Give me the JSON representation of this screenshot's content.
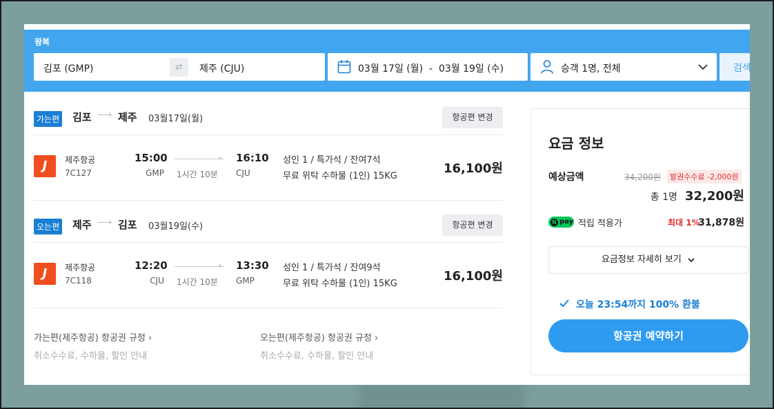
{
  "search": {
    "trip_type": "왕복",
    "from": "김포 (GMP)",
    "swap_glyph": "⇄",
    "to": "제주 (CJU)",
    "dates": "03월 17일 (월)  -  03월 19일 (수)",
    "passengers": "승객 1명, 전체",
    "search_label": "검색",
    "colors": {
      "bar": "#42a5f0",
      "accent": "#1a7fd4"
    }
  },
  "segments": [
    {
      "badge": "가는편",
      "from": "김포",
      "to": "제주",
      "arrow": "⟶",
      "date": "03월17일(월)",
      "change_label": "항공편 변경",
      "flight": {
        "airline_logo": "J",
        "airline": "제주항공",
        "flight_no": "7C127",
        "dep_time": "15:00",
        "dep_code": "GMP",
        "duration": "1시간 10분",
        "arr_time": "16:10",
        "arr_code": "CJU",
        "fare_info": "성인 1 / 특가석 / 잔여7석",
        "baggage": "무료 위탁 수하물 (1인) 15KG",
        "price": "16,100원"
      }
    },
    {
      "badge": "오는편",
      "from": "제주",
      "to": "김포",
      "arrow": "⟶",
      "date": "03월19일(수)",
      "change_label": "항공편 변경",
      "flight": {
        "airline_logo": "J",
        "airline": "제주항공",
        "flight_no": "7C118",
        "dep_time": "12:20",
        "dep_code": "CJU",
        "duration": "1시간 10분",
        "arr_time": "13:30",
        "arr_code": "GMP",
        "fare_info": "성인 1 / 특가석 / 잔여9석",
        "baggage": "무료 위탁 수하물 (1인) 15KG",
        "price": "16,100원"
      }
    }
  ],
  "rules": [
    {
      "link": "가는편(제주항공) 항공권 규정  ›",
      "sub": "취소수수료, 수하물, 할인 안내"
    },
    {
      "link": "오는편(제주항공) 항공권 규정  ›",
      "sub": "취소수수료, 수하물, 할인 안내"
    }
  ],
  "fare": {
    "title": "요금 정보",
    "estimate_label": "예상금액",
    "original_price": "34,200원",
    "discount_badge": "발권수수료 -2,000원",
    "total_label": "총 1명",
    "total_price": "32,200원",
    "npay_n": "N",
    "npay_label": "pay",
    "points_label": "적립 적용가",
    "points_max": "최대 1%",
    "points_value": "31,878원",
    "detail_label": "요금정보 자세히 보기",
    "refund_note": "오늘 23:54까지 100% 환불",
    "book_label": "항공권 예약하기"
  }
}
